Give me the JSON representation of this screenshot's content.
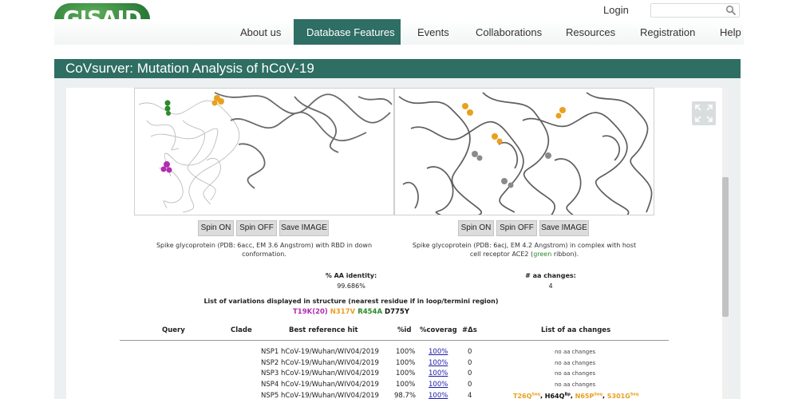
{
  "header": {
    "logo_text": "GISAID",
    "login_label": "Login",
    "search_placeholder": ""
  },
  "nav": {
    "items": [
      {
        "label": "About us",
        "active": false
      },
      {
        "label": "Database Features",
        "active": true
      },
      {
        "label": "Events",
        "active": false
      },
      {
        "label": "Collaborations",
        "active": false
      },
      {
        "label": "Resources",
        "active": false
      },
      {
        "label": "Registration",
        "active": false
      },
      {
        "label": "Help",
        "active": false
      }
    ]
  },
  "page_title": "CoVsurver: Mutation Analysis of hCoV-19",
  "viewers": [
    {
      "buttons": {
        "spin_on": "Spin ON",
        "spin_off": "Spin OFF",
        "save": "Save IMAGE"
      },
      "caption_line1": "Spike glycoprotein (PDB: 6acc, EM 3.6 Angstrom) with RBD in down",
      "caption_line2": "conformation."
    },
    {
      "buttons": {
        "spin_on": "Spin ON",
        "spin_off": "Spin OFF",
        "save": "Save IMAGE"
      },
      "caption_line1": "Spike glycoprotein (PDB: 6acj, EM 4.2 Angstrom) in complex with host",
      "caption_line2_pre": "cell receptor ACE2 (",
      "caption_line2_green": "green",
      "caption_line2_post": " ribbon)."
    }
  ],
  "stats": {
    "identity_label": "% AA identity:",
    "identity_value": "99.686%",
    "changes_label": "# aa changes:",
    "changes_value": "4"
  },
  "variations": {
    "title": "List of variations displayed in structure (nearest residue if in loop/termini region)",
    "items": [
      {
        "text": "T19K(20)",
        "color": "#b02fb0"
      },
      {
        "text": "N317V",
        "color": "#e8a020"
      },
      {
        "text": "R454A",
        "color": "#2a8a2a"
      },
      {
        "text": "D775Y",
        "color": "#111111"
      }
    ]
  },
  "table": {
    "headers": [
      "Query",
      "Clade",
      "Best reference hit",
      "%id",
      "%coverag",
      "#Δs",
      "List of aa changes"
    ],
    "rows": [
      {
        "ref": "NSP1 hCoV-19/Wuhan/WIV04/2019",
        "id": "100%",
        "coverage": "100%",
        "deltas": "0",
        "changes": "no aa changes"
      },
      {
        "ref": "NSP2 hCoV-19/Wuhan/WIV04/2019",
        "id": "100%",
        "coverage": "100%",
        "deltas": "0",
        "changes": "no aa changes"
      },
      {
        "ref": "NSP3 hCoV-19/Wuhan/WIV04/2019",
        "id": "100%",
        "coverage": "100%",
        "deltas": "0",
        "changes": "no aa changes"
      },
      {
        "ref": "NSP4 hCoV-19/Wuhan/WIV04/2019",
        "id": "100%",
        "coverage": "100%",
        "deltas": "0",
        "changes": "no aa changes"
      },
      {
        "ref": "NSP5 hCoV-19/Wuhan/WIV04/2019",
        "id": "98.7%",
        "coverage": "100%",
        "deltas": "4",
        "changes": ""
      }
    ],
    "nsp5_changes": [
      {
        "text": "T26Q",
        "sup": "Seq",
        "color": "#e8a020"
      },
      {
        "text": "H64Q",
        "sup": "Bp",
        "color": "#111111"
      },
      {
        "text": "N65P",
        "sup": "Seq",
        "color": "#e8a020"
      },
      {
        "text": "S301G",
        "sup": "Seq",
        "color": "#e8a020"
      }
    ]
  },
  "colors": {
    "brand_green": "#2f6e63",
    "logo_green": "#2f7f3b",
    "highlight_orange": "#e8a020",
    "highlight_magenta": "#b02fb0",
    "highlight_green": "#2a8a2a"
  }
}
